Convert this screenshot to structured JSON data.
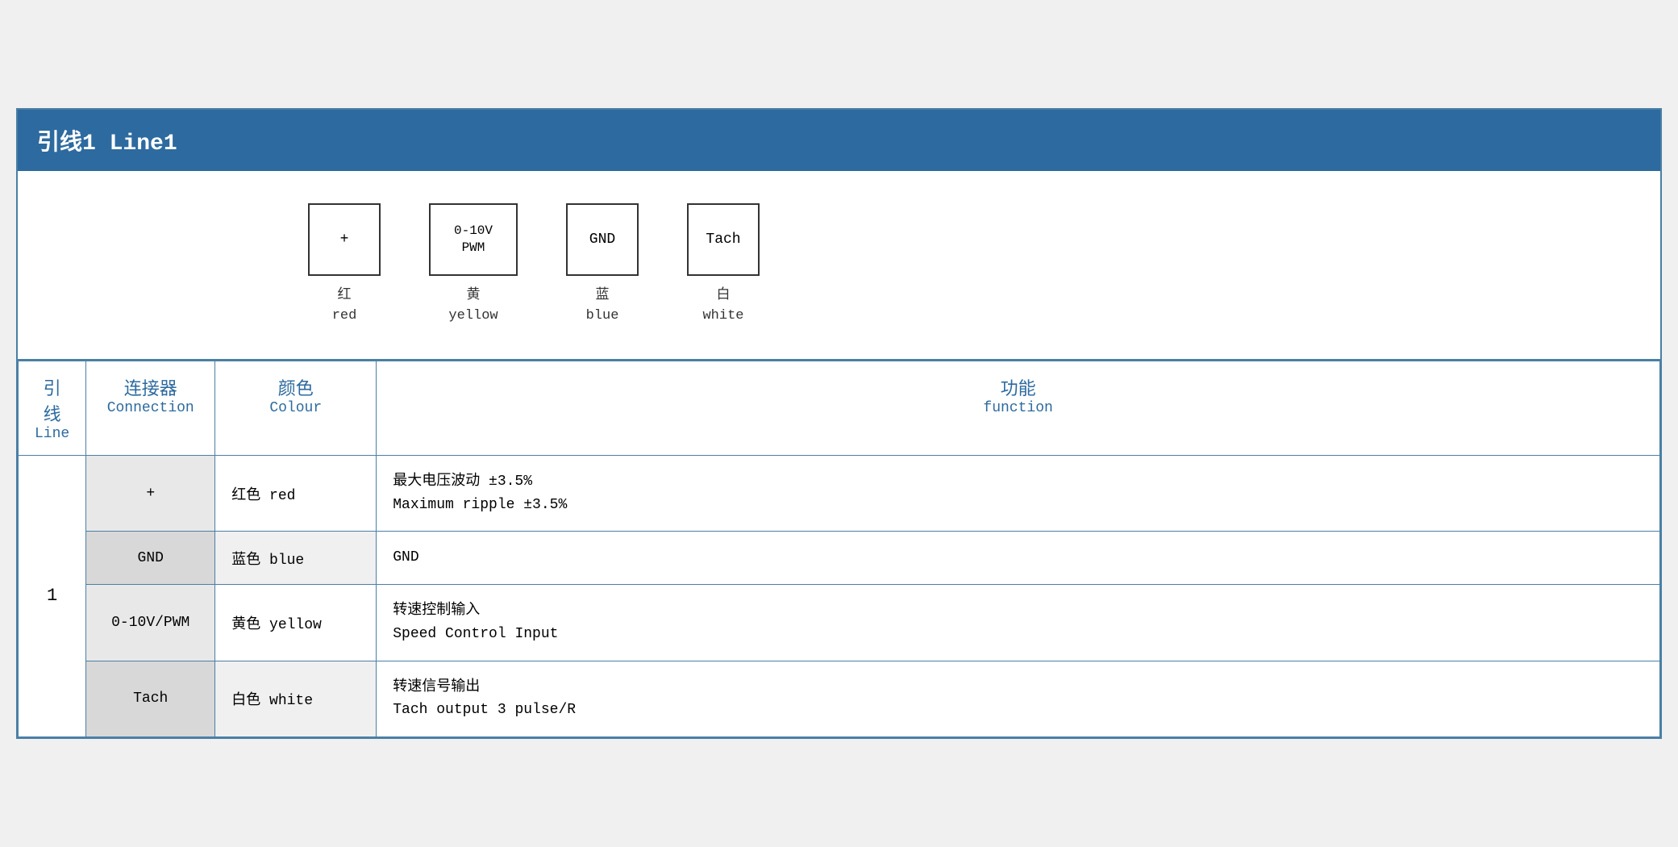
{
  "title": {
    "chinese": "引线1",
    "english": "Line1",
    "full": "引线1 Line1"
  },
  "diagram": {
    "connectors": [
      {
        "label": "+",
        "chinese_label": "红",
        "english_label": "red"
      },
      {
        "label": "0-10V\nPWM",
        "chinese_label": "黄",
        "english_label": "yellow"
      },
      {
        "label": "GND",
        "chinese_label": "蓝",
        "english_label": "blue"
      },
      {
        "label": "Tach",
        "chinese_label": "白",
        "english_label": "white"
      }
    ]
  },
  "table": {
    "headers": {
      "line_chinese": "引线",
      "line_english": "Line",
      "connection_chinese": "连接器",
      "connection_english": "Connection",
      "colour_chinese": "颜色",
      "colour_english": "Colour",
      "function_chinese": "功能",
      "function_english": "function"
    },
    "rows": [
      {
        "line": "1",
        "connection": "+",
        "colour": "红色 red",
        "function_chinese": "最大电压波动 ±3.5%",
        "function_english": "Maximum ripple ±3.5%"
      },
      {
        "line": "",
        "connection": "GND",
        "colour": "蓝色 blue",
        "function_chinese": "GND",
        "function_english": ""
      },
      {
        "line": "",
        "connection": "0-10V/PWM",
        "colour": "黄色 yellow",
        "function_chinese": "转速控制输入",
        "function_english": "Speed Control Input"
      },
      {
        "line": "",
        "connection": "Tach",
        "colour": "白色 white",
        "function_chinese": "转速信号输出",
        "function_english": "Tach output 3 pulse/R"
      }
    ]
  }
}
